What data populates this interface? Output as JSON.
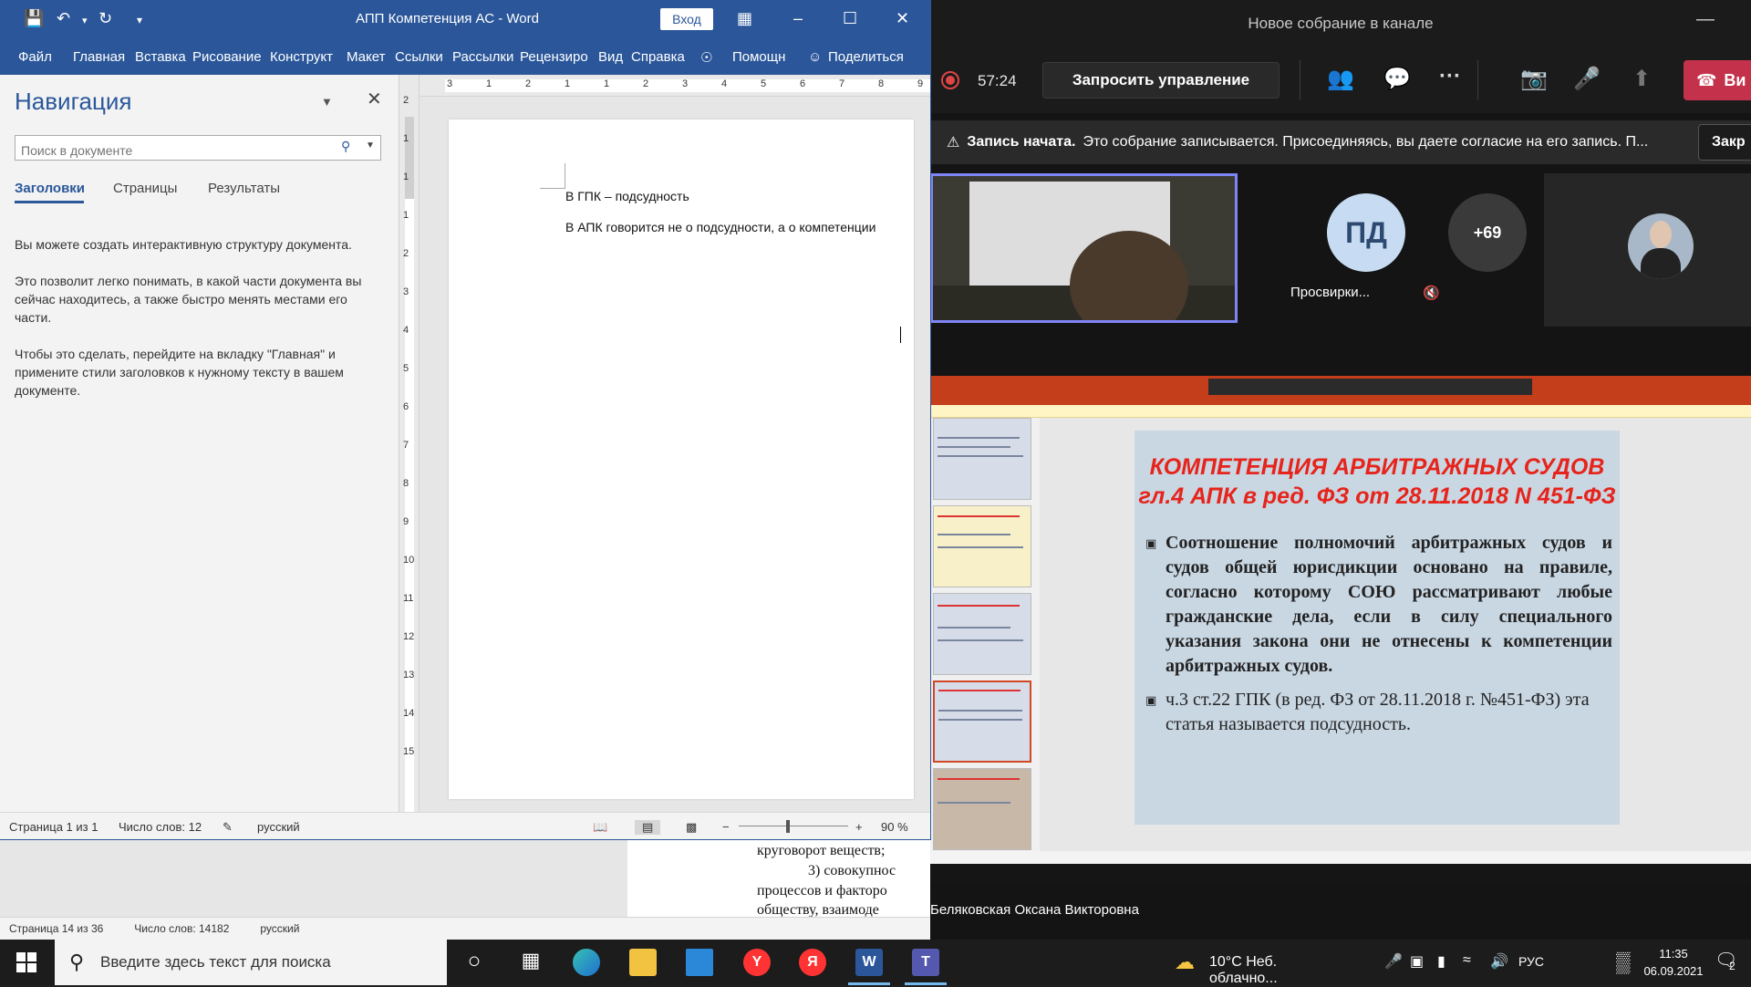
{
  "bg_word": {
    "text_lines": [
      "круговорот веществ;",
      "3) совокупнос",
      "процессов и факторо",
      "обществу,  взаимоде"
    ],
    "status": {
      "page": "Страница 14 из 36",
      "words": "Число слов: 14182",
      "language": "русский"
    }
  },
  "word": {
    "quick_access_icons": [
      "save-icon",
      "undo-icon",
      "redo-icon",
      "customize-icon"
    ],
    "title": "АПП Компетенция АС  -  Word",
    "signin_label": "Вход",
    "tabs": [
      "Файл",
      "Главная",
      "Вставка",
      "Рисование",
      "Конструкт",
      "Макет",
      "Ссылки",
      "Рассылки",
      "Рецензиро",
      "Вид",
      "Справка"
    ],
    "help_label": "Помощн",
    "share_label": "Поделиться",
    "nav": {
      "title": "Навигация",
      "search_placeholder": "Поиск в документе",
      "tabs": [
        "Заголовки",
        "Страницы",
        "Результаты"
      ],
      "paragraphs": [
        "Вы можете создать интерактивную структуру документа.",
        "Это позволит легко понимать, в какой части документа вы сейчас находитесь, а также быстро менять местами его части.",
        "Чтобы это сделать, перейдите на вкладку \"Главная\" и примените стили заголовков к нужному тексту в вашем документе."
      ]
    },
    "ruler_top": [
      "3",
      "1",
      "2",
      "1",
      "1",
      "2",
      "3",
      "4",
      "5",
      "6",
      "7",
      "8",
      "9"
    ],
    "ruler_left": [
      "2",
      "1",
      "1",
      "1",
      "2",
      "3",
      "4",
      "5",
      "6",
      "7",
      "8",
      "9",
      "10",
      "11",
      "12",
      "13",
      "14",
      "15"
    ],
    "document": {
      "line1": "В ГПК – подсудность",
      "line2": "В АПК говорится не о подсудности, а о компетенции"
    },
    "status": {
      "page": "Страница 1 из 1",
      "words": "Число слов: 12",
      "language": "русский",
      "zoom": "90 %"
    }
  },
  "teams": {
    "title": "Новое собрание в канале",
    "timer": "57:24",
    "request_control_label": "Запросить управление",
    "hangup_label": "Ви",
    "toolbar_icons": [
      "participants-icon",
      "chat-icon",
      "more-icon",
      "camera-off-icon",
      "mic-off-icon",
      "share-icon",
      "phone-icon"
    ],
    "recording_banner": {
      "title": "Запись начата.",
      "text": "Это собрание записывается. Присоединяясь, вы даете согласие на его запись. П...",
      "close_label": "Закр"
    },
    "participants": {
      "initials": "ПД",
      "name": "Просвирки...",
      "more_count": "+69"
    },
    "slide": {
      "title_line1": "КОМПЕТЕНЦИЯ АРБИТРАЖНЫХ СУДОВ",
      "title_line2": "гл.4 АПК в ред. ФЗ от 28.11.2018 N 451-ФЗ",
      "bullet1": "Соотношение полномочий арбитражных судов и судов общей юрисдикции основано на правиле, согласно которому СОЮ рассматривают любые гражданские дела, если в силу специального указания закона они не отнесены к компетенции арбитражных судов.",
      "bullet2": "ч.3 ст.22 ГПК (в ред. ФЗ от 28.11.2018 г. №451-ФЗ) эта статья называется подсудность."
    },
    "presenter": "Беляковская Оксана Викторовна"
  },
  "taskbar": {
    "search_placeholder": "Введите здесь текст для поиска",
    "apps": [
      "cortana-icon",
      "task-view-icon",
      "edge-icon",
      "explorer-icon",
      "mail-icon",
      "yandex-browser-icon",
      "yandex-icon",
      "word-icon",
      "teams-icon"
    ],
    "weather": "10°C  Неб. облачно...",
    "lang": "РУС",
    "time": "11:35",
    "date": "06.09.2021",
    "notifications": "2"
  },
  "colors": {
    "word_blue": "#2b579a",
    "teams_hangup": "#c4314b",
    "slide_title": "#e6241b",
    "ppt_ribbon": "#c43e1c"
  }
}
